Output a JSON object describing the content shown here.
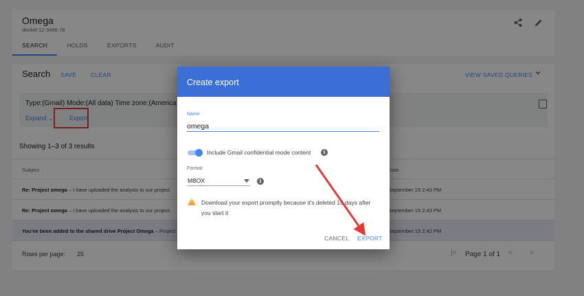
{
  "matter": {
    "title": "Omega",
    "subtitle": "docket 12-3456-78"
  },
  "tabs": [
    {
      "label": "SEARCH",
      "active": true
    },
    {
      "label": "HOLDS"
    },
    {
      "label": "EXPORTS"
    },
    {
      "label": "AUDIT"
    }
  ],
  "header_icons": {
    "share": "share-icon",
    "edit": "pencil-icon"
  },
  "search": {
    "title": "Search",
    "save_label": "SAVE",
    "clear_label": "CLEAR",
    "view_saved_label": "VIEW SAVED QUERIES",
    "query_text": "Type:(Gmail) Mode:(All data) Time zone:(America",
    "expand_label": "Expand",
    "export_label": "Export"
  },
  "results": {
    "count_text": "Showing 1–3 of 3 results",
    "columns": {
      "subject": "Subject",
      "date": "Date"
    },
    "rows": [
      {
        "subject": "Re: Project omega",
        "snippet": " – I have uploaded the analysis to our project",
        "date": "September 15 2:43 PM"
      },
      {
        "subject": "Re: Project omega",
        "snippet": " – I have uploaded the analysis to our project",
        "date": "September 15 2:43 PM"
      },
      {
        "subject": "You've been added to the shared drive Project Omega",
        "snippet": " – Project",
        "date": "September 15 2:42 PM"
      }
    ],
    "rows_per_page_label": "Rows per page:",
    "rows_per_page_value": "25",
    "page_text": "Page 1 of 1"
  },
  "dialog": {
    "title": "Create export",
    "name_label": "Name",
    "name_value": "omega",
    "toggle_label": "Include Gmail confidential mode content",
    "toggle_on": true,
    "format_label": "Format",
    "format_value": "MBOX",
    "warning_text": "Download your export promptly because it's deleted 15 days after you start it",
    "cancel_label": "CANCEL",
    "export_label": "EXPORT"
  },
  "colors": {
    "accent": "#4285f4",
    "dialog_header": "#3b6fd6",
    "annotation": "#e53935",
    "warning": "#f4a62a"
  }
}
